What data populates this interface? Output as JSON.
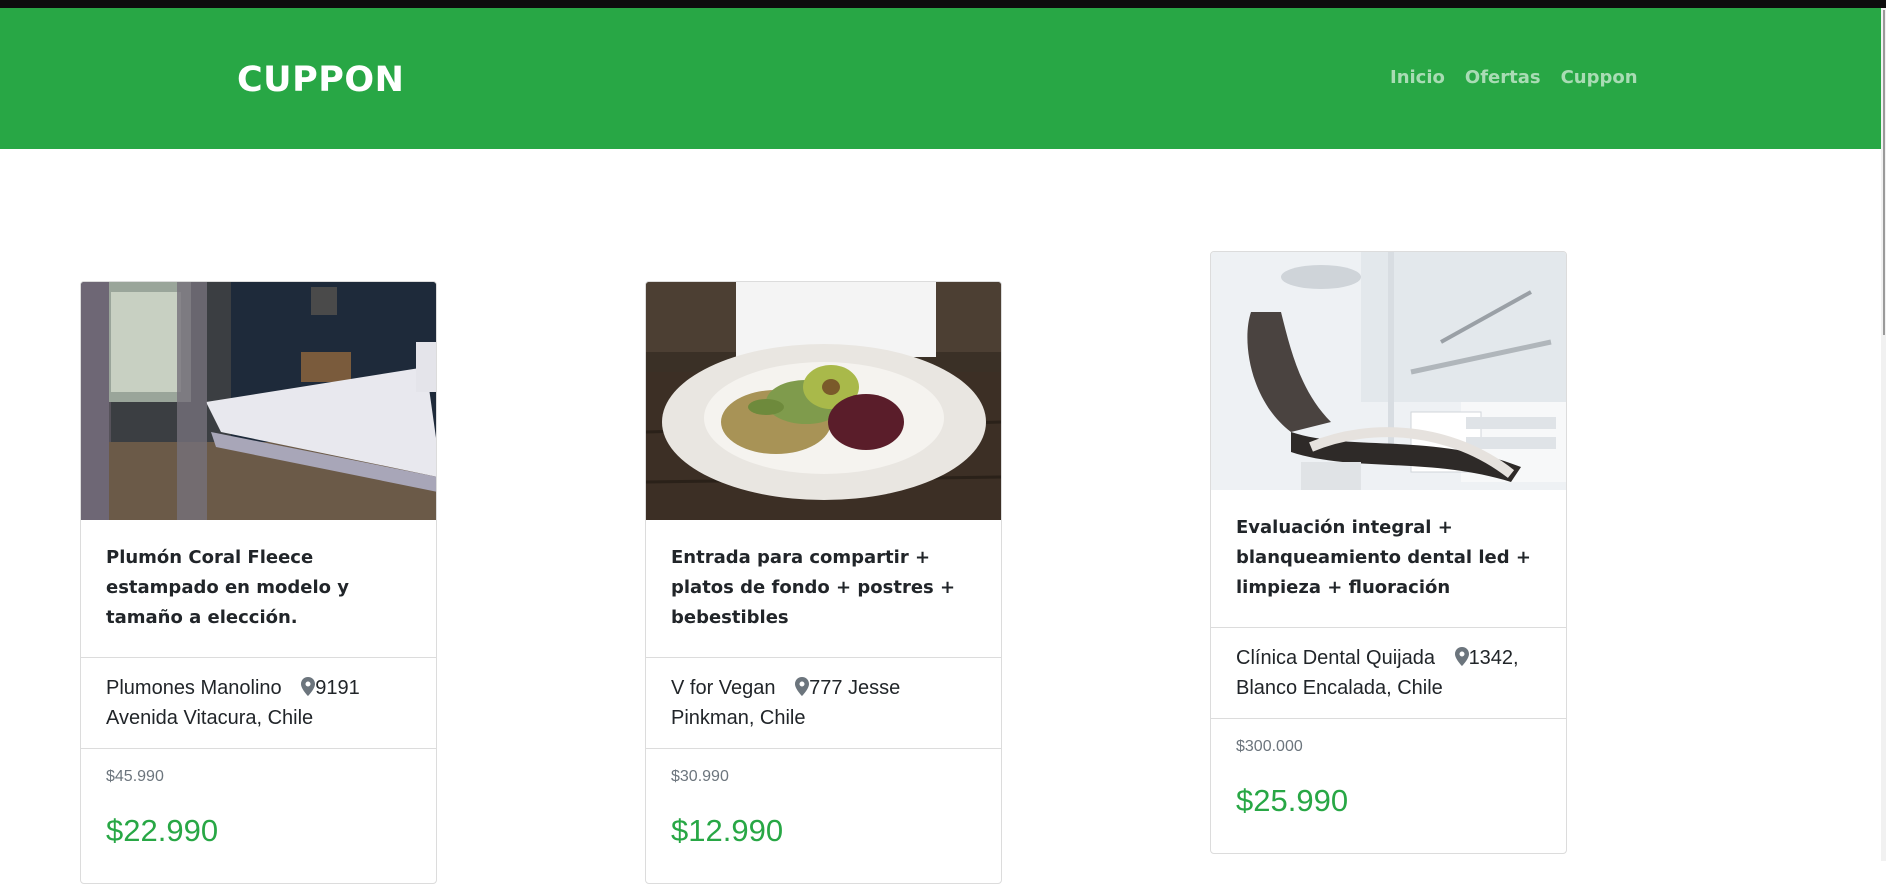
{
  "brand": "CUPPON",
  "nav": {
    "items": [
      "Inicio",
      "Ofertas",
      "Cuppon"
    ]
  },
  "colors": {
    "primary": "#28a745",
    "text": "#212529",
    "muted": "#6c757d"
  },
  "cards": [
    {
      "image": "bedroom-bed-photo",
      "title": "Plumón Coral Fleece estampado en modelo y tamaño a elección.",
      "merchant": "Plumones Manolino",
      "address": "9191 Avenida Vitacura, Chile",
      "old_price": "$45.990",
      "price": "$22.990"
    },
    {
      "image": "vegan-salad-plate-photo",
      "title": "Entrada para compartir + platos de fondo + postres + bebestibles",
      "merchant": "V for Vegan",
      "address": "777 Jesse Pinkman, Chile",
      "old_price": "$30.990",
      "price": "$12.990"
    },
    {
      "image": "dental-chair-photo",
      "title": "Evaluación integral + blanqueamiento dental led + limpieza + fluoración",
      "merchant": "Clínica Dental Quijada",
      "address": "1342, Blanco Encalada, Chile",
      "old_price": "$300.000",
      "price": "$25.990"
    }
  ]
}
